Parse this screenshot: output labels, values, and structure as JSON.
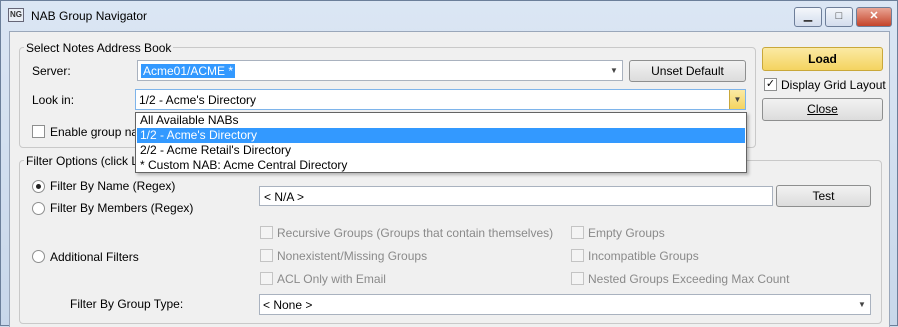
{
  "window": {
    "title": "NAB Group Navigator",
    "app_icon": "app-icon",
    "minimize_glyph": "▁",
    "maximize_glyph": "□",
    "close_glyph": "✕"
  },
  "nab_group": {
    "title": "Select Notes Address Book",
    "server_label": "Server:",
    "server_value": "Acme01/ACME *",
    "unset_default": "Unset Default",
    "look_in_label": "Look in:",
    "look_in_value": "1/2 - Acme's Directory",
    "enable_label": "Enable group na"
  },
  "dropdown": {
    "options": [
      "All Available NABs",
      "1/2 - Acme's Directory",
      "2/2 - Acme Retail's Directory",
      " * Custom NAB: Acme Central Directory"
    ],
    "selected_index": 1
  },
  "right_panel": {
    "load": "Load",
    "display_grid_layout": "Display Grid Layout",
    "display_grid_checked": true,
    "close": "Close"
  },
  "filter_group": {
    "title": "Filter Options (click L",
    "by_name": "Filter By Name (Regex)",
    "by_members": "Filter By Members (Regex)",
    "additional": "Additional Filters",
    "selected_mode": "by_name",
    "regex_value": "< N/A >",
    "test": "Test",
    "checks_left": [
      "Recursive Groups (Groups that contain themselves)",
      "Nonexistent/Missing Groups",
      "ACL Only with Email"
    ],
    "checks_right": [
      "Empty Groups",
      "Incompatible Groups",
      "Nested Groups Exceeding Max Count"
    ],
    "group_type_label": "Filter By Group Type:",
    "group_type_value": "< None >"
  }
}
